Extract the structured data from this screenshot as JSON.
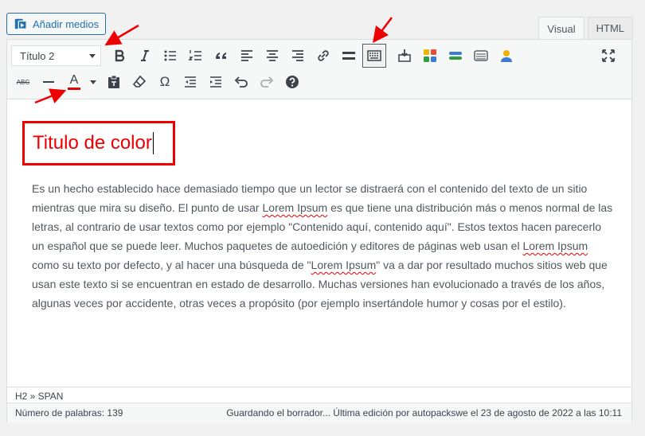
{
  "add_media": {
    "label": "Añadir medios",
    "icon": "media-icon"
  },
  "tabs": [
    {
      "label": "Visual",
      "active": true
    },
    {
      "label": "HTML",
      "active": false
    }
  ],
  "toolbar": {
    "format_value": "Título 2",
    "row1_icons": [
      "bold-icon",
      "italic-icon",
      "bulleted-list-icon",
      "numbered-list-icon",
      "blockquote-icon",
      "align-left-icon",
      "align-center-icon",
      "align-right-icon",
      "link-icon",
      "read-more-icon",
      "toolbar-toggle-icon",
      "insert-icon",
      "color-grid-icon",
      "toggle-bar-icon",
      "table-icon",
      "user-icon",
      "fullscreen-icon"
    ],
    "row2_icons": [
      "strikethrough-icon",
      "horizontal-line-icon",
      "text-color-icon",
      "text-color-dropdown-icon",
      "paste-text-icon",
      "clear-formatting-icon",
      "special-character-icon",
      "outdent-icon",
      "indent-icon",
      "undo-icon",
      "redo-icon",
      "help-icon"
    ],
    "strike_label": "ABC",
    "text_color_glyph": "A",
    "omega_glyph": "Ω",
    "text_color_accent": "#e00000"
  },
  "content": {
    "heading": "Titulo de color",
    "paragraph": [
      "Es un hecho establecido hace demasiado tiempo que un lector se distraerá con el contenido del texto de un sitio mientras que mira su diseño. El punto de usar ",
      "Lorem Ipsum",
      " es que tiene una distribución más o menos normal de las letras, al contrario de usar textos como por ejemplo \"Contenido aquí, contenido aquí\". Estos textos hacen parecerlo un español que se puede leer. Muchos paquetes de autoedición y editores de páginas web usan el ",
      "Lorem Ipsum",
      " como su texto por defecto, y al hacer una búsqueda de \"",
      "Lorem Ipsum",
      "\" va a dar por resultado muchos sitios web que usan este texto si se encuentran en estado de desarrollo. Muchas versiones han evolucionado a través de los años, algunas veces por accidente, otras veces a propósito (por ejemplo insertándole humor y cosas por el estilo)."
    ]
  },
  "path": "H2 » SPAN",
  "status": {
    "word_count": "Número de palabras: 139",
    "saving": "Guardando el borrador... Última edición por autopackswe el 23 de agosto de 2022 a las 10:11"
  },
  "colors": {
    "accent": "#2271b1",
    "highlight": "#e00000"
  }
}
